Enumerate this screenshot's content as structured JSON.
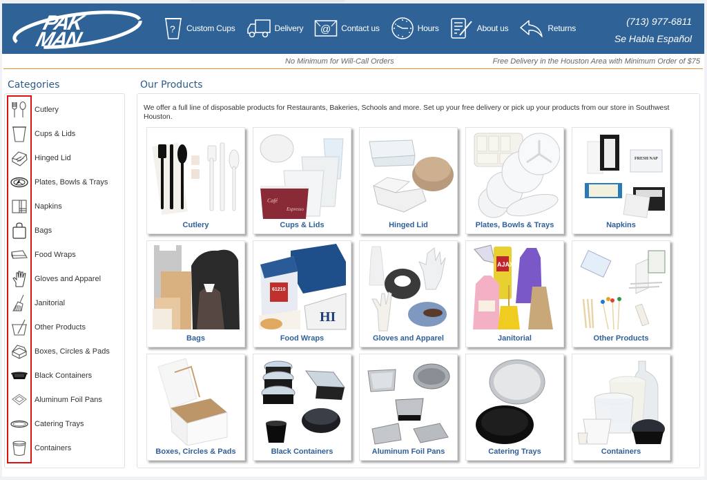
{
  "brand": {
    "name": "PAK MAN",
    "color": "#2f6397",
    "accent": "#ef8a2c"
  },
  "header": {
    "nav": [
      {
        "label": "Custom Cups",
        "icon": "custom-cup-icon"
      },
      {
        "label": "Delivery",
        "icon": "truck-icon"
      },
      {
        "label": "Contact us",
        "icon": "envelope-at-icon"
      },
      {
        "label": "Hours",
        "icon": "clock-icon"
      },
      {
        "label": "About us",
        "icon": "notepad-pen-icon"
      },
      {
        "label": "Returns",
        "icon": "return-arrow-icon"
      }
    ],
    "phone": "(713) 977-6811",
    "language_note": "Se Habla Español"
  },
  "infobar": {
    "left": "No Minimum for Will-Call Orders",
    "right": "Free Delivery in the Houston Area with Minimum Order of $75"
  },
  "sidebar": {
    "title": "Categories",
    "items": [
      {
        "label": "Cutlery",
        "icon": "cutlery-icon"
      },
      {
        "label": "Cups & Lids",
        "icon": "cup-icon"
      },
      {
        "label": "Hinged Lid",
        "icon": "hinged-lid-icon"
      },
      {
        "label": "Plates, Bowls & Trays",
        "icon": "plate-icon"
      },
      {
        "label": "Napkins",
        "icon": "napkin-icon"
      },
      {
        "label": "Bags",
        "icon": "bag-icon"
      },
      {
        "label": "Food Wraps",
        "icon": "food-wrap-icon"
      },
      {
        "label": "Gloves and Apparel",
        "icon": "glove-icon"
      },
      {
        "label": "Janitorial",
        "icon": "broom-icon"
      },
      {
        "label": "Other Products",
        "icon": "other-products-icon"
      },
      {
        "label": "Boxes, Circles & Pads",
        "icon": "box-icon"
      },
      {
        "label": "Black Containers",
        "icon": "black-container-icon"
      },
      {
        "label": "Aluminum Foil Pans",
        "icon": "foil-pan-icon"
      },
      {
        "label": "Catering Trays",
        "icon": "catering-tray-icon"
      },
      {
        "label": "Containers",
        "icon": "container-icon"
      }
    ]
  },
  "products": {
    "title": "Our Products",
    "intro": "We offer a full line of disposable products for Restaurants, Bakeries, Schools and more.  Set up your free delivery or pick up your products from our store in Southwest Houston.",
    "cards": [
      {
        "label": "Cutlery",
        "image": "cutlery-image"
      },
      {
        "label": "Cups & Lids",
        "image": "cups-lids-image"
      },
      {
        "label": "Hinged Lid",
        "image": "hinged-lid-image"
      },
      {
        "label": "Plates, Bowls & Trays",
        "image": "plates-image"
      },
      {
        "label": "Napkins",
        "image": "napkins-image"
      },
      {
        "label": "Bags",
        "image": "bags-image"
      },
      {
        "label": "Food Wraps",
        "image": "food-wraps-image"
      },
      {
        "label": "Gloves and Apparel",
        "image": "gloves-image"
      },
      {
        "label": "Janitorial",
        "image": "janitorial-image"
      },
      {
        "label": "Other Products",
        "image": "other-products-image"
      },
      {
        "label": "Boxes, Circles & Pads",
        "image": "boxes-image"
      },
      {
        "label": "Black Containers",
        "image": "black-containers-image"
      },
      {
        "label": "Aluminum Foil Pans",
        "image": "foil-pans-image"
      },
      {
        "label": "Catering Trays",
        "image": "catering-trays-image"
      },
      {
        "label": "Containers",
        "image": "containers-image"
      }
    ]
  }
}
